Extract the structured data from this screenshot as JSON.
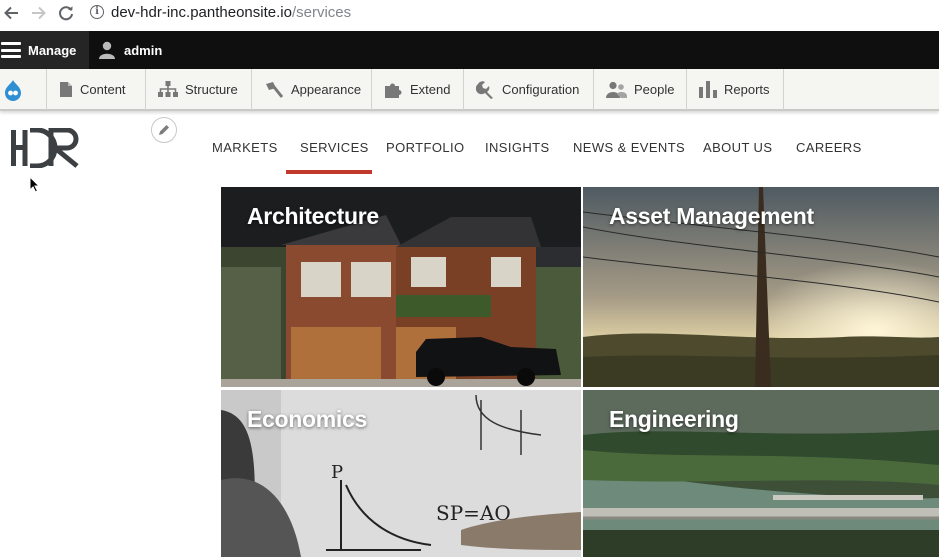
{
  "browser": {
    "url_host": "dev-hdr-inc.pantheonsite.io",
    "url_path": "/services"
  },
  "admin_bar": {
    "manage_label": "Manage",
    "user_label": "admin"
  },
  "admin_tray": {
    "items": [
      {
        "label": "Content",
        "icon": "document-icon"
      },
      {
        "label": "Structure",
        "icon": "sitemap-icon"
      },
      {
        "label": "Appearance",
        "icon": "paint-brush-icon"
      },
      {
        "label": "Extend",
        "icon": "puzzle-icon"
      },
      {
        "label": "Configuration",
        "icon": "wrench-icon"
      },
      {
        "label": "People",
        "icon": "people-icon"
      },
      {
        "label": "Reports",
        "icon": "bar-chart-icon"
      }
    ]
  },
  "site": {
    "logo_text": "HDR",
    "nav": [
      {
        "label": "MARKETS"
      },
      {
        "label": "SERVICES",
        "active": true
      },
      {
        "label": "PORTFOLIO"
      },
      {
        "label": "INSIGHTS"
      },
      {
        "label": "NEWS & EVENTS"
      },
      {
        "label": "ABOUT US"
      },
      {
        "label": "CAREERS"
      }
    ],
    "accent_color": "#c0392b"
  },
  "services": [
    {
      "title": "Architecture"
    },
    {
      "title": "Asset Management"
    },
    {
      "title": "Economics"
    },
    {
      "title": "Engineering"
    }
  ]
}
